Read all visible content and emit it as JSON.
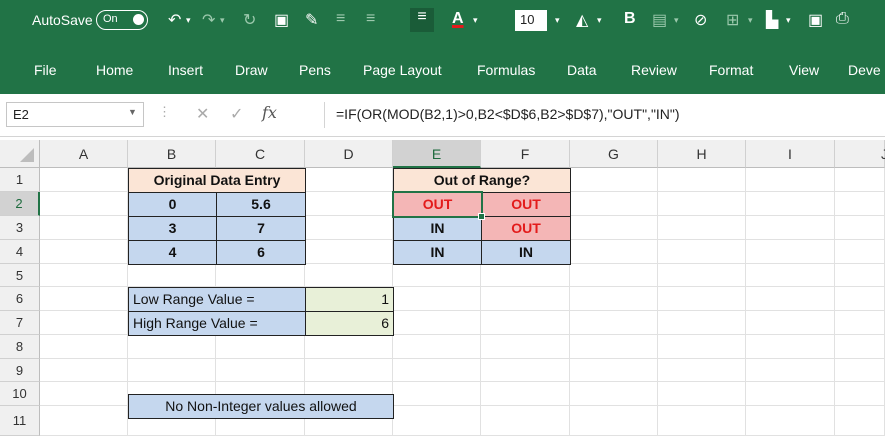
{
  "qat": {
    "autosave_label": "AutoSave",
    "toggle_label": "On",
    "font_size": "10",
    "bold_label": "B"
  },
  "ribbon": {
    "tabs": [
      "File",
      "Home",
      "Insert",
      "Draw",
      "Pens",
      "Page Layout",
      "Formulas",
      "Data",
      "Review",
      "Format",
      "View",
      "Deve"
    ]
  },
  "formula_bar": {
    "name_box": "E2",
    "fx_label": "fx",
    "formula": "=IF(OR(MOD(B2,1)>0,B2<$D$6,B2>$D$7),\"OUT\",\"IN\")"
  },
  "sheet": {
    "columns": [
      "A",
      "B",
      "C",
      "D",
      "E",
      "F",
      "G",
      "H",
      "I",
      "J"
    ],
    "rows": [
      "1",
      "2",
      "3",
      "4",
      "5",
      "6",
      "7",
      "8",
      "9",
      "10",
      "11"
    ],
    "selected_cell": "E2",
    "original_header": "Original Data Entry",
    "range_header": "Out of Range?",
    "data": [
      {
        "b": "0",
        "c": "5.6",
        "e": "OUT",
        "f": "OUT"
      },
      {
        "b": "3",
        "c": "7",
        "e": "IN",
        "f": "OUT"
      },
      {
        "b": "4",
        "c": "6",
        "e": "IN",
        "f": "IN"
      }
    ],
    "low_label": "Low Range Value =",
    "low_value": "1",
    "high_label": "High Range Value =",
    "high_value": "6",
    "note": "No Non-Integer values allowed"
  },
  "colors": {
    "excel_green": "#217346",
    "header_fill": "#fbe5d6",
    "data_fill": "#c5d7ee",
    "out_fill": "#f4b6b6",
    "out_text": "#e31b1b",
    "input_fill": "#e8f0d8"
  }
}
